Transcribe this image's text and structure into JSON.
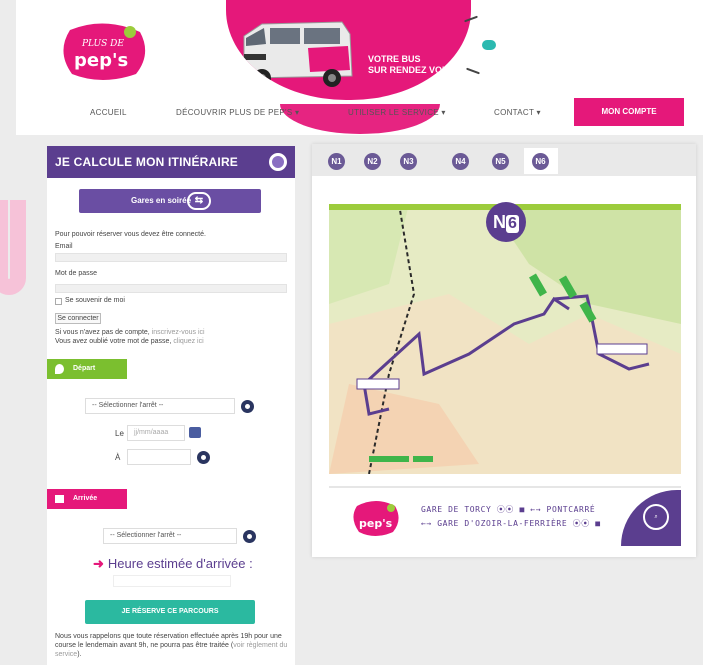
{
  "header": {
    "logo_text": [
      "PLUS DE",
      "pep's"
    ],
    "hero_lines": [
      "VOTRE BUS",
      "SUR RENDEZ VOUS"
    ]
  },
  "nav": {
    "items": [
      "ACCUEIL",
      "DÉCOUVRIR PLUS DE PEP'S ▾",
      "UTILISER LE SERVICE ▾",
      "CONTACT ▾"
    ],
    "account": "MON COMPTE"
  },
  "itinerary": {
    "title": "JE CALCULE MON ITINÉRAIRE",
    "gares_button": "Gares en soirée",
    "login_notice": "Pour pouvoir réserver vous devez être connecté.",
    "email_label": "Email",
    "password_label": "Mot de passe",
    "remember_label": "Se souvenir de moi",
    "connect_button": "Se connecter",
    "no_account": "Si vous n'avez pas de compte,",
    "no_account_link": "inscrivez-vous ici",
    "forgot": "Vous avez oublié votre mot de passe,",
    "forgot_link": "cliquez ici",
    "depart_label": "Départ",
    "select_stop_placeholder": "-- Sélectionner l'arrêt --",
    "date_prefix": "Le",
    "date_placeholder": "jj/mm/aaaa",
    "time_prefix": "À",
    "arrivee_label": "Arrivée",
    "heure_label": "Heure estimée d'arrivée :",
    "reserve_button": "JE RÉSERVE CE PARCOURS",
    "note_text": "Nous vous rappelons que toute réservation effectuée après 19h pour une course le lendemain avant 9h, ne pourra pas être traitée (",
    "note_link": "voir règlement du service",
    "note_end": ")."
  },
  "map": {
    "tabs": [
      "N1",
      "N2",
      "N3",
      "N4",
      "N5",
      "N6"
    ],
    "active_tab": "N6",
    "line_badge_letter": "N",
    "line_badge_number": "6",
    "footer_line1": "GARE DE TORCY ⦿⦿ ■ ←→ PONTCARRÉ",
    "footer_line2": "←→ GARE D'OZOIR-LA-FERRIÈRE ⦿⦿ ■",
    "colors": {
      "purple": "#5b3e8f",
      "pink": "#e5187a",
      "green": "#7bbf2f",
      "teal": "#2bb9a0"
    }
  }
}
